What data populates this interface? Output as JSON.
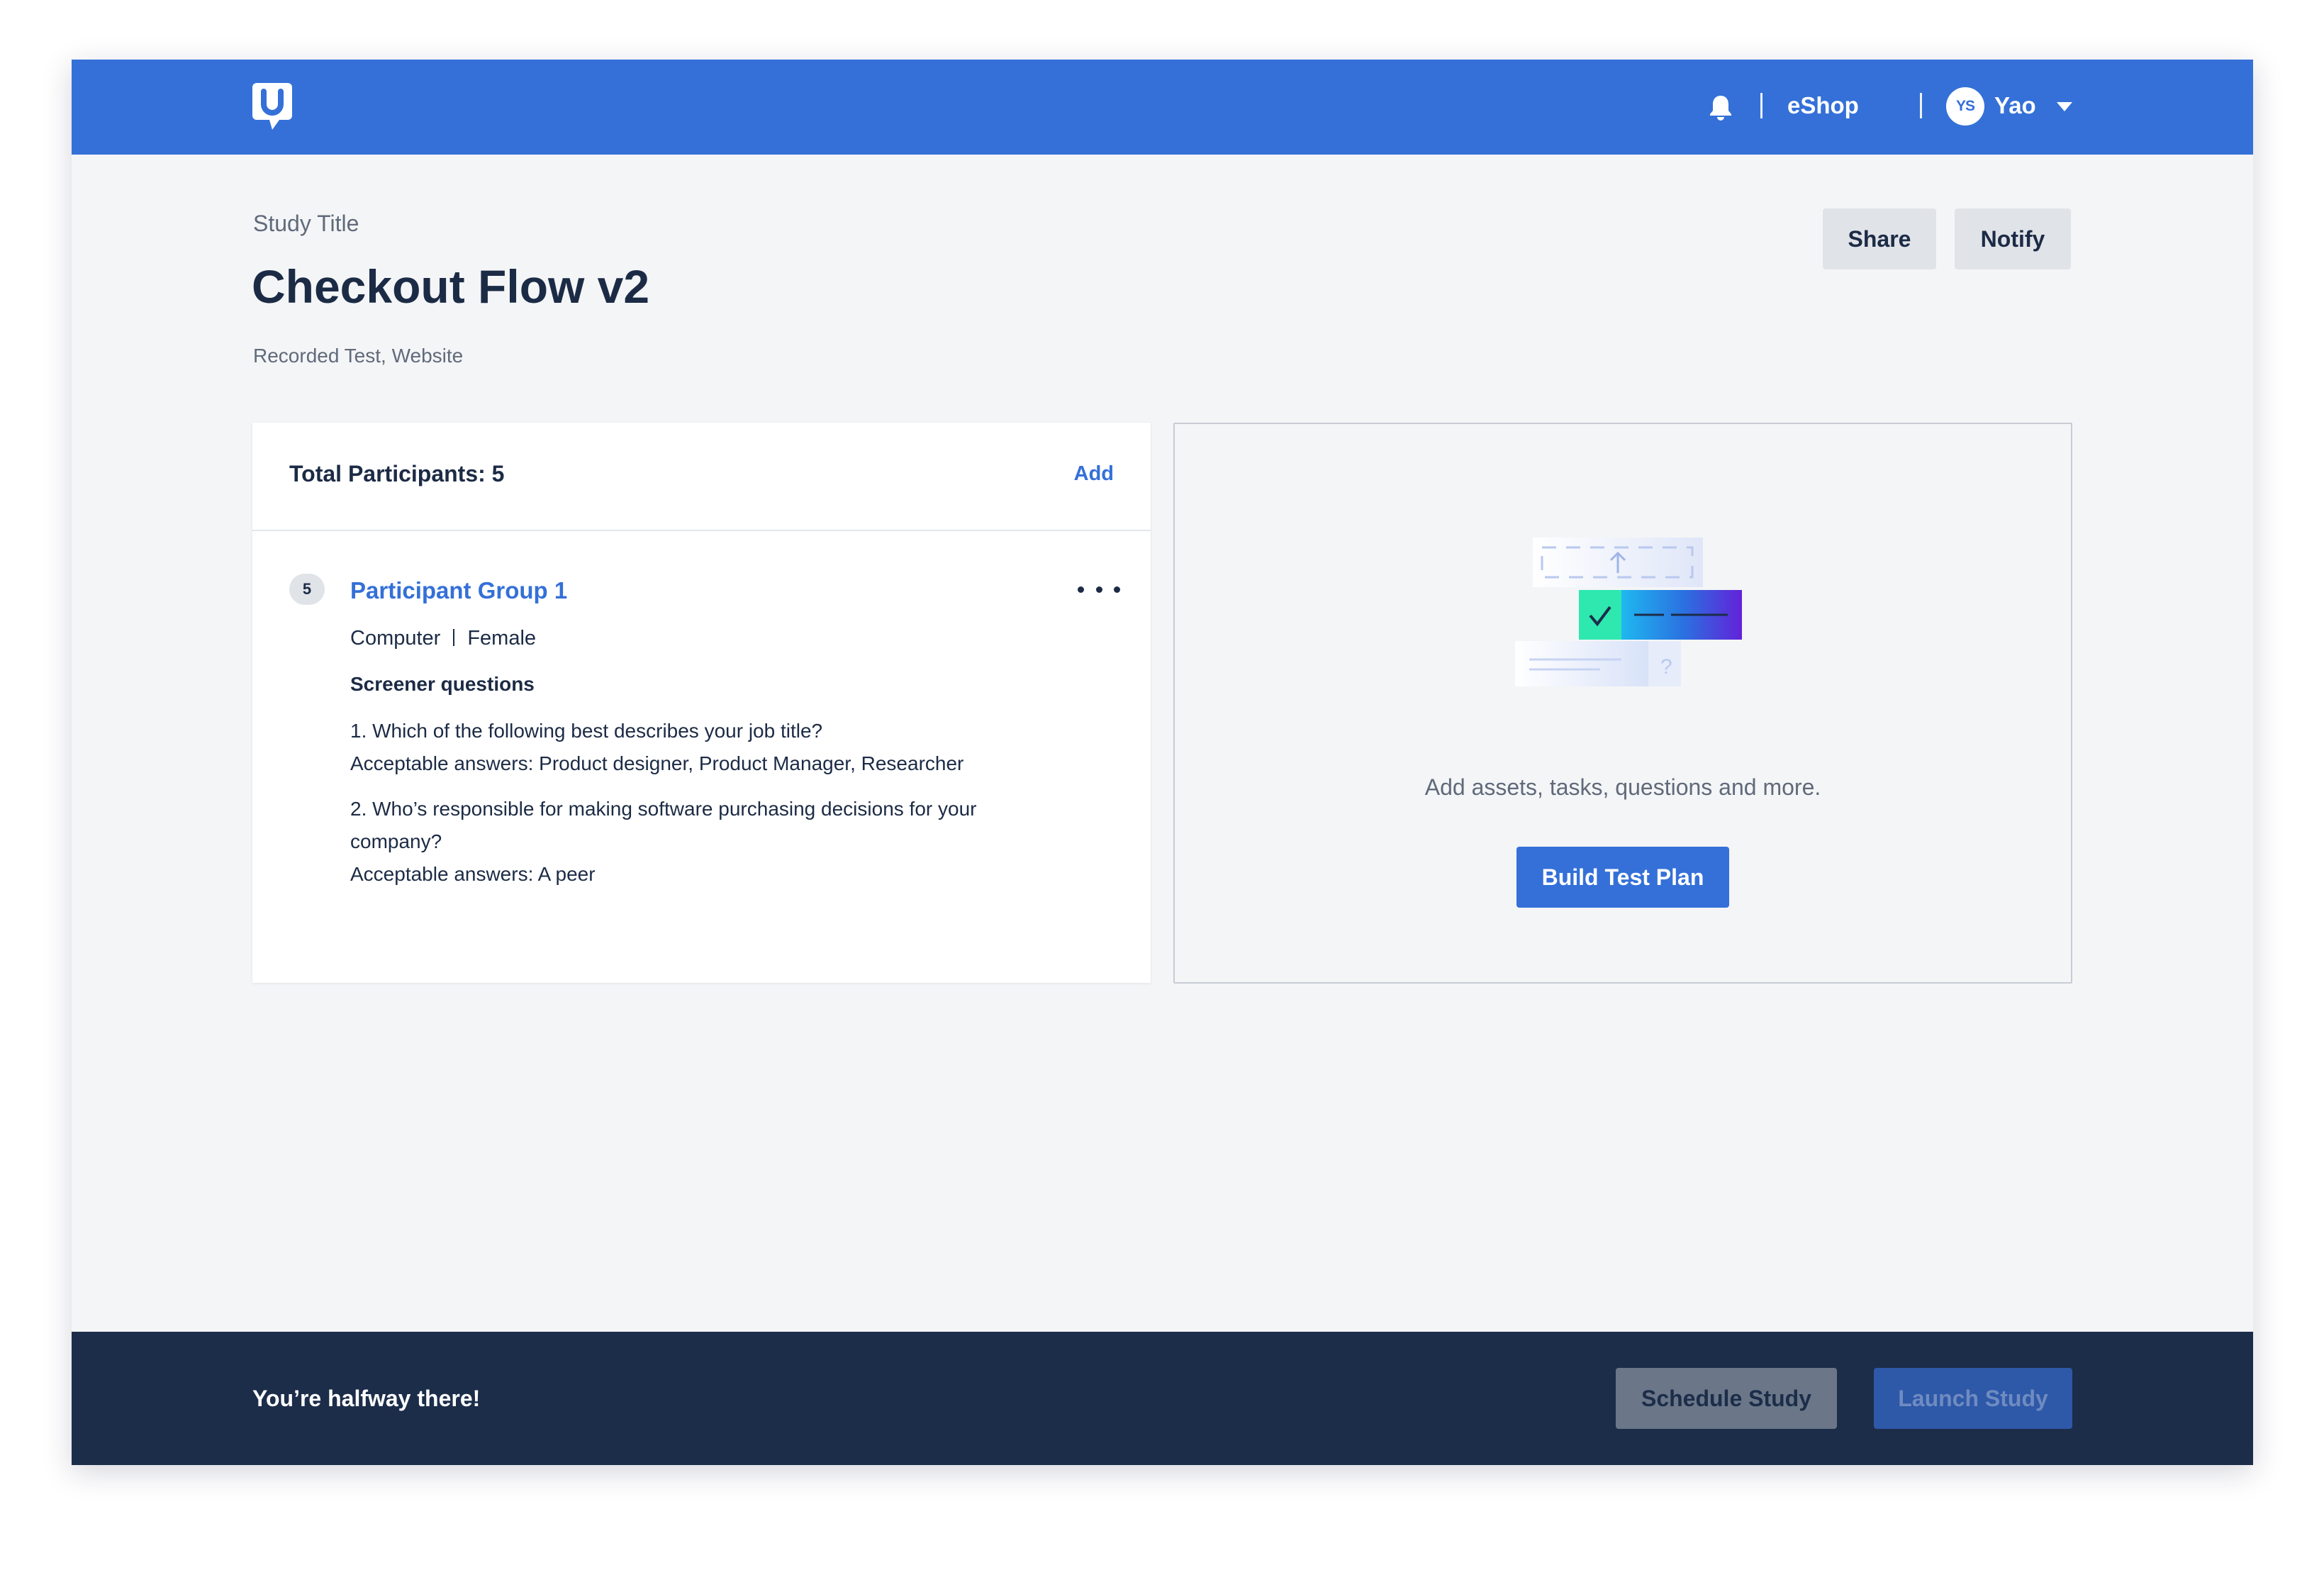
{
  "header": {
    "logo_icon": "usertesting-logo-icon",
    "notifications_icon": "bell-icon",
    "org_name": "eShop",
    "user_initials": "YS",
    "user_name": "Yao"
  },
  "study": {
    "label": "Study Title",
    "title": "Checkout Flow v2",
    "subtitle": "Recorded Test, Website",
    "share_label": "Share",
    "notify_label": "Notify"
  },
  "participants": {
    "total_label": "Total Participants: 5",
    "add_label": "Add",
    "groups": [
      {
        "count": "5",
        "name": "Participant Group 1",
        "device": "Computer",
        "gender": "Female",
        "screener_heading": "Screener questions",
        "questions": [
          {
            "question": "1. Which of the following best describes your job title?",
            "answers": "Acceptable answers: Product designer, Product Manager, Researcher"
          },
          {
            "question": "2. Who’s responsible for making software purchasing decisions for your company?",
            "answers": "Acceptable answers: A peer"
          }
        ]
      }
    ]
  },
  "test_plan": {
    "illustration_icon": "test-plan-illustration-icon",
    "prompt": "Add assets, tasks, questions and more.",
    "build_label": "Build Test Plan"
  },
  "footer": {
    "progress_message": "You’re halfway there!",
    "schedule_label": "Schedule Study",
    "launch_label": "Launch Study"
  },
  "colors": {
    "brand_blue": "#3470d8",
    "navy": "#1c2d4a",
    "page_bg": "#f4f5f7"
  }
}
